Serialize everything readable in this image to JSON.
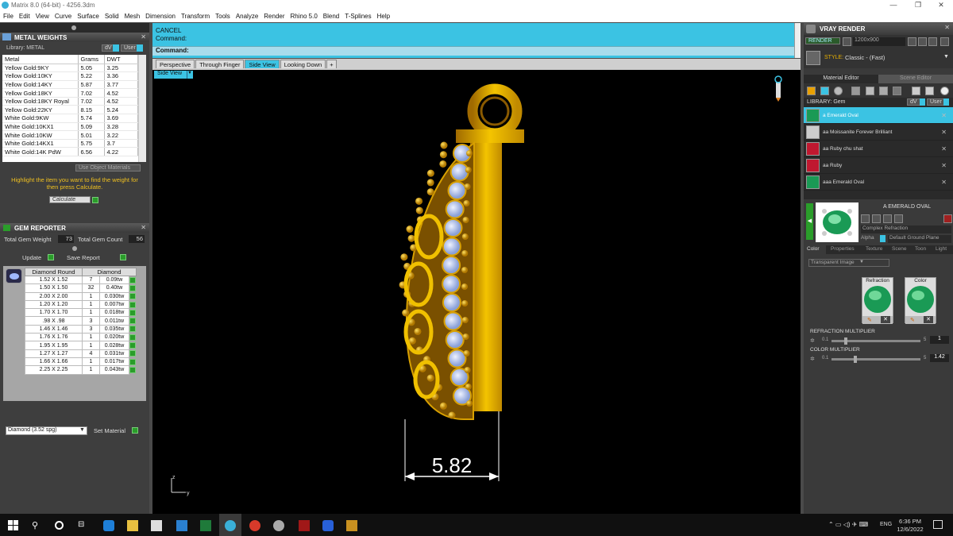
{
  "window": {
    "title": "Matrix 8.0 (64-bit) - 4256.3dm",
    "min": "—",
    "max": "❐",
    "close": "✕"
  },
  "menu": [
    "File",
    "Edit",
    "View",
    "Curve",
    "Surface",
    "Solid",
    "Mesh",
    "Dimension",
    "Transform",
    "Tools",
    "Analyze",
    "Render",
    "Rhino 5.0",
    "Blend",
    "T-Splines",
    "Help"
  ],
  "metal": {
    "title": "METAL WEIGHTS",
    "library_label": "Library: METAL",
    "dv": "dV",
    "user": "User",
    "headers": [
      "Metal",
      "Grams",
      "DWT"
    ],
    "rows": [
      [
        "Yellow Gold:9KY",
        "5.05",
        "3.25"
      ],
      [
        "Yellow Gold:10KY",
        "5.22",
        "3.36"
      ],
      [
        "Yellow Gold:14KY",
        "5.87",
        "3.77"
      ],
      [
        "Yellow Gold:18KY",
        "7.02",
        "4.52"
      ],
      [
        "Yellow Gold:18KY Royal",
        "7.02",
        "4.52"
      ],
      [
        "Yellow Gold:22KY",
        "8.15",
        "5.24"
      ],
      [
        "White Gold:9KW",
        "5.74",
        "3.69"
      ],
      [
        "White Gold:10KX1",
        "5.09",
        "3.28"
      ],
      [
        "White Gold:10KW",
        "5.01",
        "3.22"
      ],
      [
        "White Gold:14KX1",
        "5.75",
        "3.7"
      ],
      [
        "White Gold:14K PdW",
        "6.56",
        "4.22"
      ]
    ],
    "use_object_materials": "Use Object Materials",
    "hint": "Highlight the item you want to find the weight for then press Calculate.",
    "calculate": "Calculate"
  },
  "gem": {
    "title": "GEM REPORTER",
    "total_weight_label": "Total Gem Weight",
    "total_weight": "73",
    "total_count_label": "Total Gem Count",
    "total_count": "56",
    "update": "Update",
    "save_report": "Save Report",
    "headers": [
      "Diamond Round",
      "Diamond"
    ],
    "rows": [
      [
        "1.52 X 1.52",
        "7",
        "0.09tw"
      ],
      [
        "1.50 X 1.50",
        "32",
        "0.40tw"
      ],
      [
        "2.00 X 2.00",
        "1",
        "0.030tw"
      ],
      [
        "1.20 X 1.20",
        "1",
        "0.007tw"
      ],
      [
        "1.70 X 1.70",
        "1",
        "0.018tw"
      ],
      [
        ".98 X .98",
        "3",
        "0.011tw"
      ],
      [
        "1.46 X 1.46",
        "3",
        "0.035tw"
      ],
      [
        "1.76 X 1.76",
        "1",
        "0.020tw"
      ],
      [
        "1.95 X 1.95",
        "1",
        "0.028tw"
      ],
      [
        "1.27 X 1.27",
        "4",
        "0.031tw"
      ],
      [
        "1.66 X 1.66",
        "1",
        "0.017tw"
      ],
      [
        "2.25 X 2.25",
        "1",
        "0.043tw"
      ]
    ],
    "material_select": "Diamond    (3.52 spg)",
    "set_material": "Set Material"
  },
  "command": {
    "line1": "CANCEL",
    "line2": "Command:",
    "prompt": "Command:"
  },
  "viewtabs": [
    "Perspective",
    "Through Finger",
    "Side View",
    "Looking Down"
  ],
  "view_label": "Side View",
  "dimension": "5.82",
  "axis": {
    "z": "z",
    "y": "y"
  },
  "vray": {
    "title": "VRAY RENDER",
    "render": "RENDER",
    "resolution": "1200x900",
    "style_label": "STYLE:",
    "style": "Classic - (Fast)",
    "tabs": [
      "Material Editor",
      "Scene Editor"
    ],
    "library_label": "LIBRARY: Gem",
    "items": [
      {
        "name": "a Emerald Oval",
        "color": "#1a9a55"
      },
      {
        "name": "aa Moissanite Forever Brilliant",
        "color": "#cccccc"
      },
      {
        "name": "aa Ruby chu shat",
        "color": "#c01830"
      },
      {
        "name": "aa Ruby",
        "color": "#c01830"
      },
      {
        "name": "aaa Emerald Oval",
        "color": "#1a9a55"
      }
    ],
    "selected_name": "A EMERALD OVAL",
    "shader": "Complex Refraction",
    "alpha": "Alpha",
    "ground": "Default Ground Plane",
    "subtabs": [
      "Color",
      "Properties",
      "Texture",
      "Scene",
      "Toon",
      "Light"
    ],
    "transparent": "Transparent Image",
    "refraction": "Refraction",
    "color": "Color",
    "refr_mult_label": "REFRACTION MULTIPLIER",
    "refr_min": "0.1",
    "refr_max": "5",
    "refr_val": "1",
    "color_mult_label": "COLOR MULTIPLIER",
    "col_min": "0.1",
    "col_max": "5",
    "col_val": "1.42"
  },
  "taskbar": {
    "time": "6:36 PM",
    "date": "12/6/2022",
    "lang": "ENG"
  },
  "colors": {
    "accent": "#3bc3e3",
    "gold": "#e8b000",
    "gem": "#b8c8f8"
  }
}
